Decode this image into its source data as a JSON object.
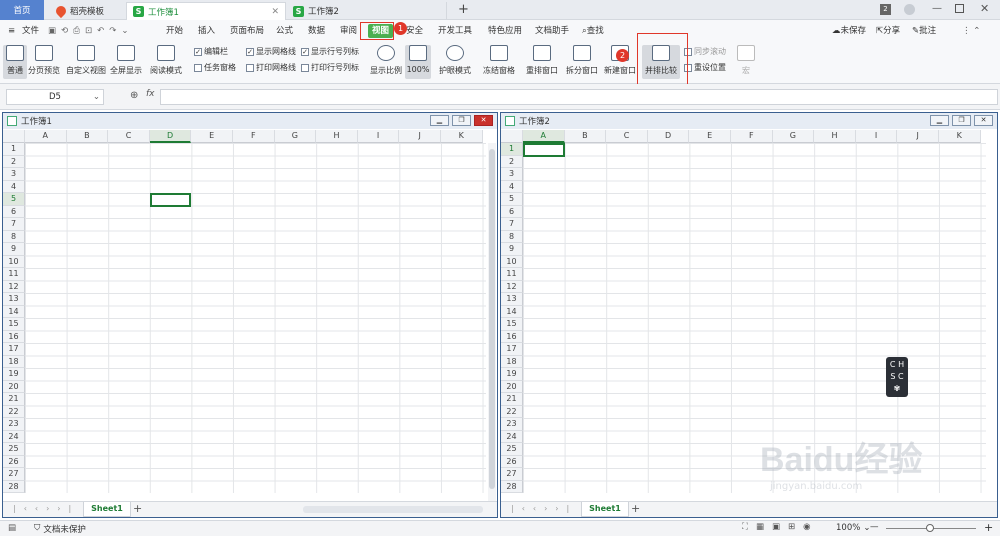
{
  "titlebar": {
    "home": "首页",
    "tabs": [
      {
        "label": "稻壳模板"
      },
      {
        "label": "工作簿1"
      },
      {
        "label": "工作簿2"
      }
    ],
    "add": "+",
    "page_count": "2"
  },
  "menubar": {
    "file": "文件",
    "items": [
      "开始",
      "插入",
      "页面布局",
      "公式",
      "数据",
      "审阅",
      "视图",
      "安全",
      "开发工具",
      "特色应用",
      "文档助手"
    ],
    "search": "查找",
    "save_status": "未保存",
    "share": "分享",
    "comment": "批注"
  },
  "badges": {
    "one": "1",
    "two": "2"
  },
  "ribbon": {
    "buttons": [
      "普通",
      "分页预览",
      "自定义视图",
      "全屏显示",
      "阅读模式",
      "显示比例",
      "100%",
      "护眼模式",
      "冻结窗格",
      "重排窗口",
      "拆分窗口",
      "新建窗口",
      "并排比较",
      "同步滚动",
      "重设位置",
      "宏"
    ],
    "checks": [
      {
        "label": "编辑栏",
        "checked": true
      },
      {
        "label": "任务窗格",
        "checked": false
      },
      {
        "label": "显示网格线",
        "checked": true
      },
      {
        "label": "打印网格线",
        "checked": false
      },
      {
        "label": "显示行号列标",
        "checked": true
      },
      {
        "label": "打印行号列标",
        "checked": false
      }
    ]
  },
  "formula": {
    "cell": "D5",
    "fx": "fx"
  },
  "windows": [
    {
      "title": "工作簿1",
      "sheet": "Sheet1",
      "selected_col": "D",
      "selected_row": 5
    },
    {
      "title": "工作簿2",
      "sheet": "Sheet1",
      "selected_col": "A",
      "selected_row": 1
    }
  ],
  "columns": [
    "A",
    "B",
    "C",
    "D",
    "E",
    "F",
    "G",
    "H",
    "I",
    "J",
    "K"
  ],
  "status": {
    "protect": "文档未保护",
    "zoom": "100%"
  },
  "chs": [
    "C",
    "H",
    "S",
    "C"
  ],
  "watermark": {
    "main": "Baidu经验",
    "sub": "jingyan.baidu.com"
  }
}
